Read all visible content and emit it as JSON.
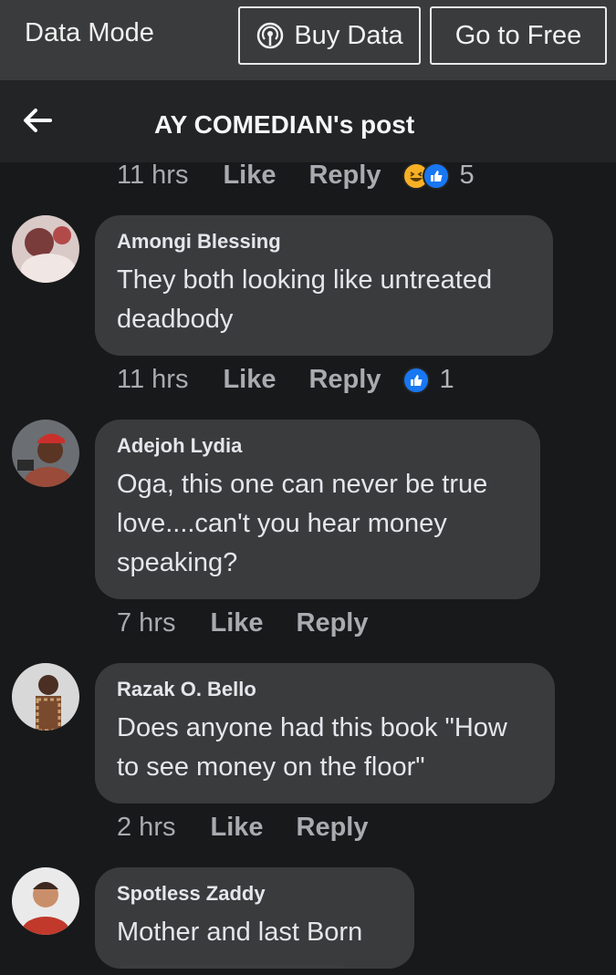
{
  "topbar": {
    "mode_label": "Data Mode",
    "buy_label": "Buy Data",
    "free_label": "Go to Free"
  },
  "header": {
    "title": "AY COMEDIAN's post"
  },
  "first_meta": {
    "time": "11 hrs",
    "like": "Like",
    "reply": "Reply",
    "reaction_count": "5"
  },
  "comments": [
    {
      "name": "Amongi Blessing",
      "text": "They both looking like untreated deadbody",
      "time": "11 hrs",
      "like": "Like",
      "reply": "Reply",
      "reaction_count": "1"
    },
    {
      "name": "Adejoh Lydia",
      "text": "Oga, this one can never be true love....can't you hear money speaking?",
      "time": "7 hrs",
      "like": "Like",
      "reply": "Reply"
    },
    {
      "name": "Razak O. Bello",
      "text": "Does anyone had this book \"How to see money on the floor\"",
      "time": "2 hrs",
      "like": "Like",
      "reply": "Reply"
    },
    {
      "name": "Spotless Zaddy",
      "text": "Mother and last Born"
    }
  ],
  "colors": {
    "background": "#18191a",
    "bubble": "#3a3b3c",
    "like_blue": "#1877f2",
    "haha_yellow": "#f7b125"
  },
  "icons": {
    "back": "arrow-left-icon",
    "buy": "wireless-broadcast-icon",
    "haha": "haha-reaction-icon",
    "like": "like-reaction-icon"
  }
}
